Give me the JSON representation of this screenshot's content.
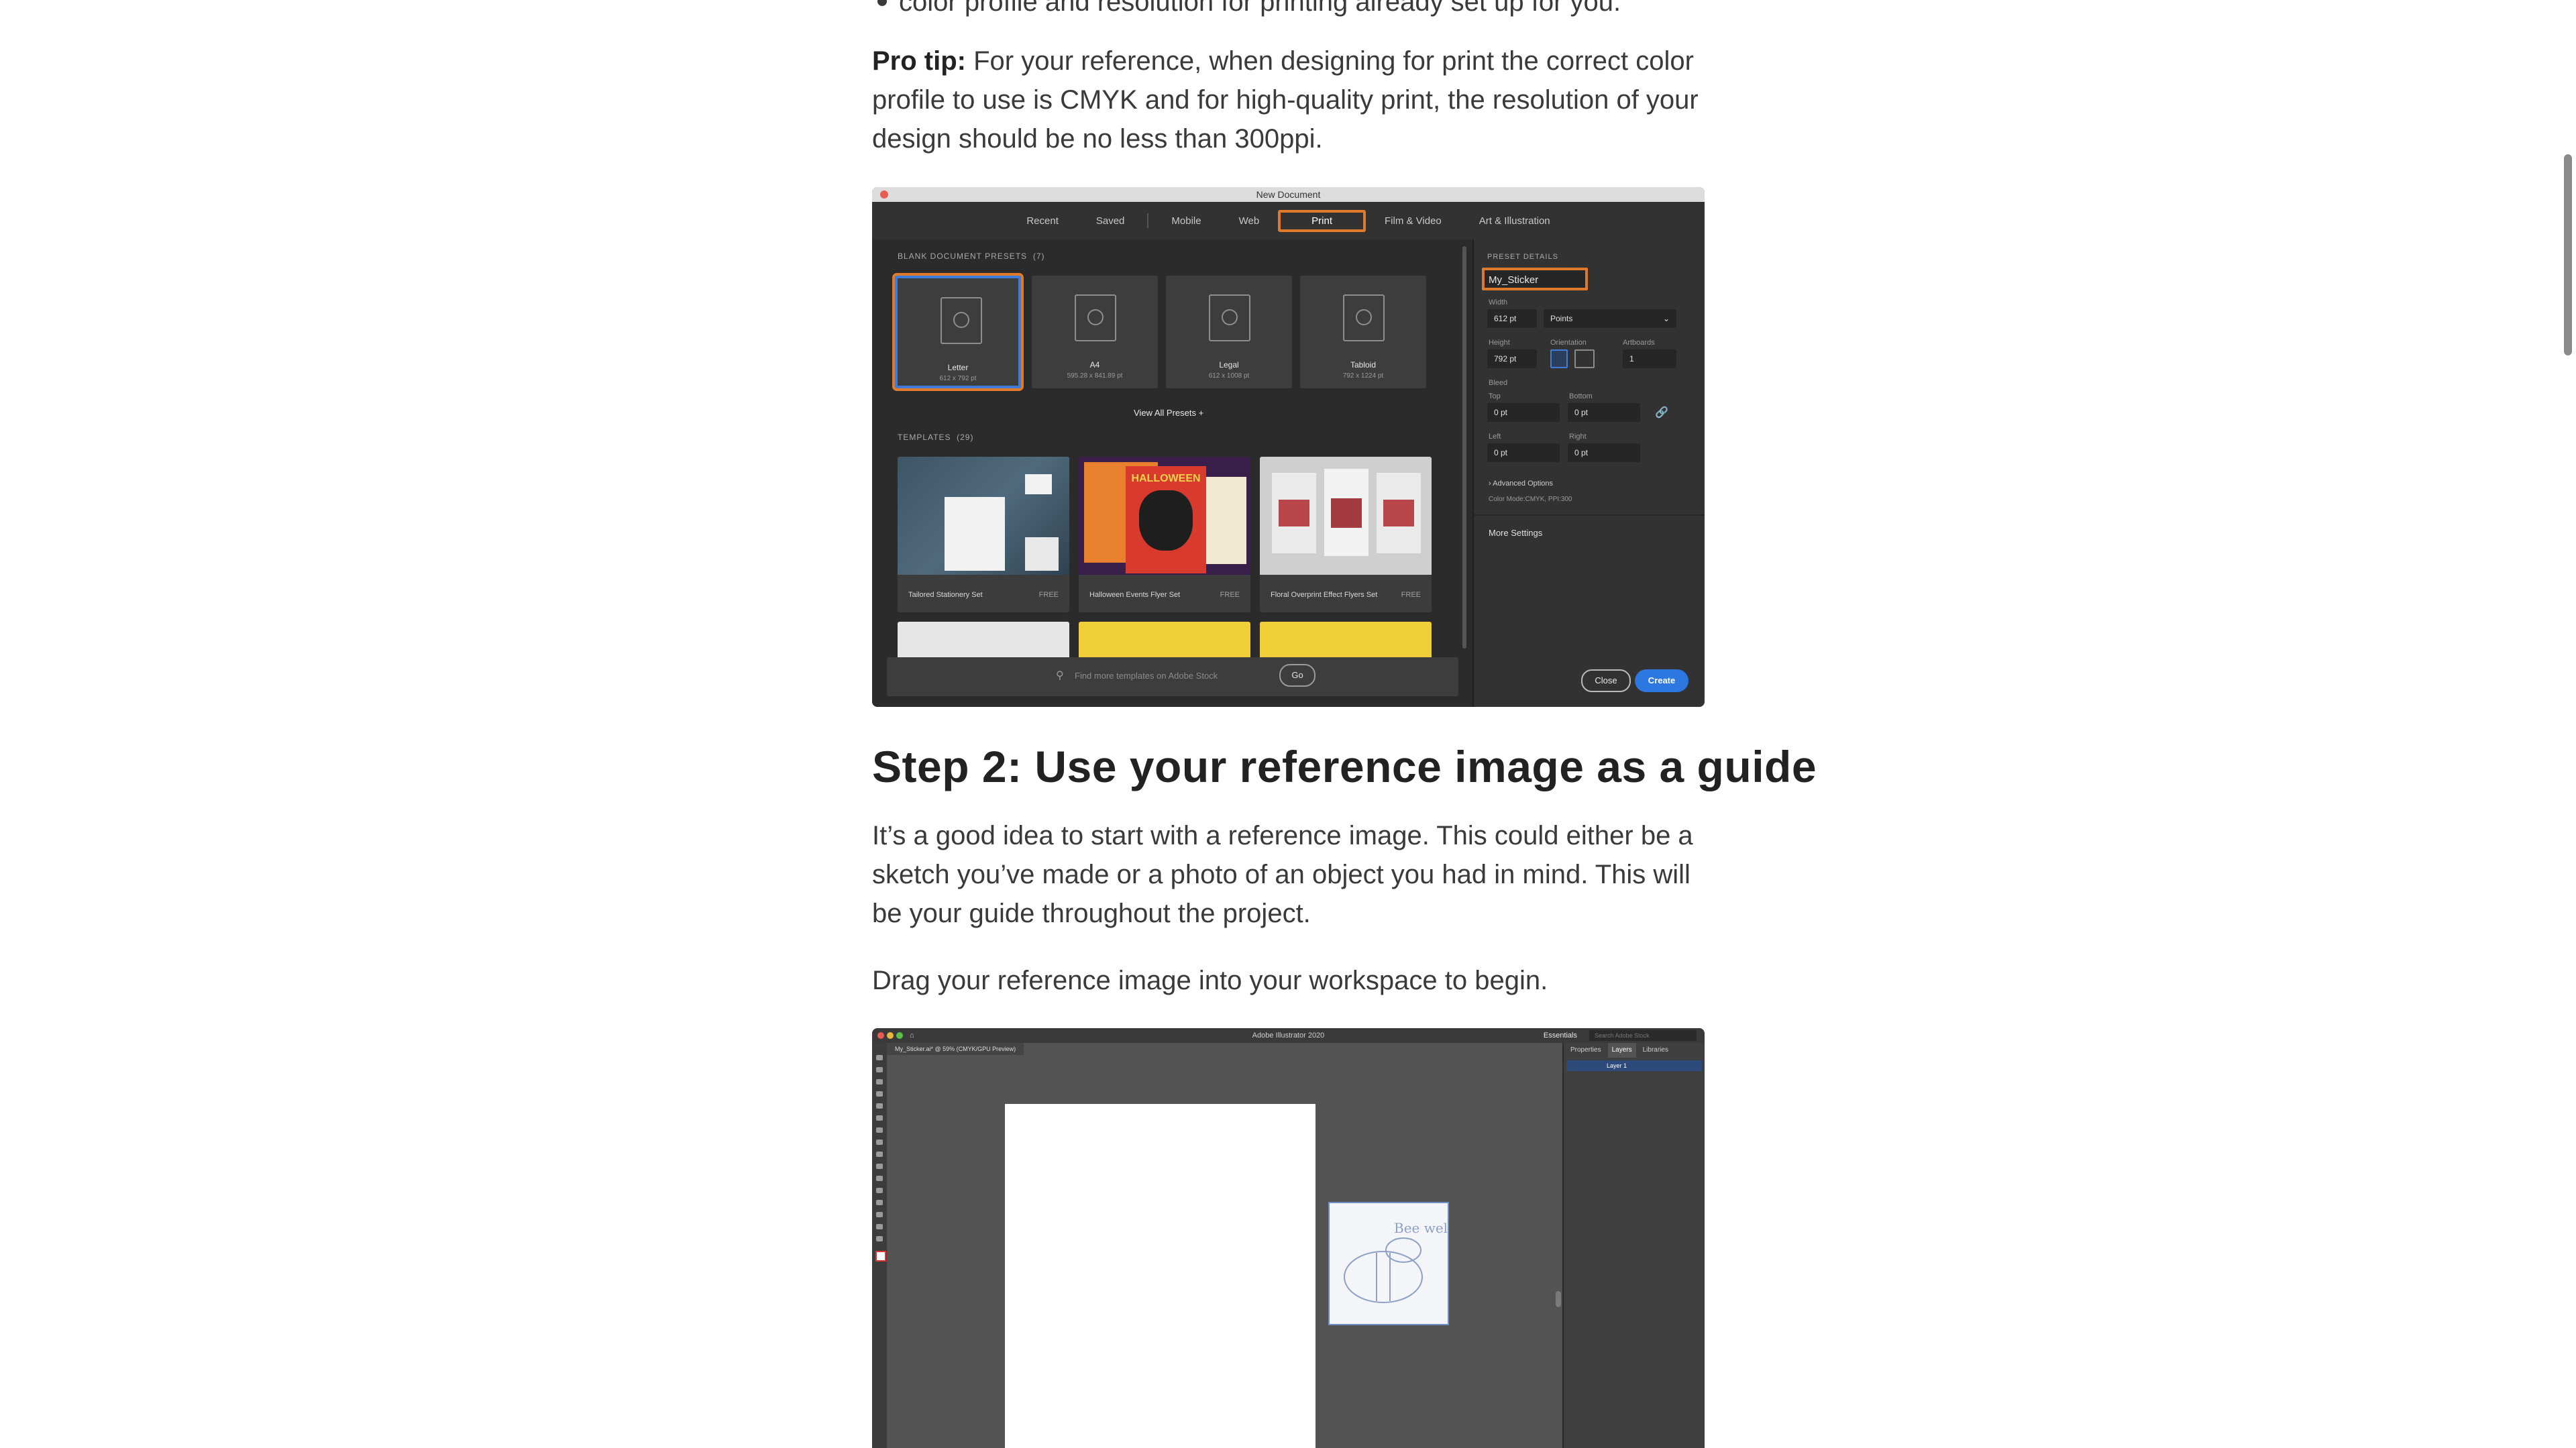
{
  "article": {
    "prev_line": "color profile and resolution for printing already set up for you.",
    "pro_tip_label": "Pro tip:",
    "pro_tip_text": " For your reference, when designing for print the correct color profile to use is CMYK and for high-quality print, the resolution of your design should be no less than 300ppi.",
    "step2_heading": "Step 2: Use your reference image as a guide",
    "step2_para": "It’s a good idea to start with a reference image. This could either be a sketch you’ve made or a photo of an object you had in mind. This will be your guide throughout the project.",
    "drag_para": "Drag your reference image into your workspace to begin."
  },
  "new_document": {
    "title": "New Document",
    "tabs": [
      "Recent",
      "Saved",
      "Mobile",
      "Web",
      "Print",
      "Film & Video",
      "Art & Illustration"
    ],
    "active_tab": "Print",
    "presets_header": "BLANK DOCUMENT PRESETS",
    "presets_count": "(7)",
    "presets": [
      {
        "name": "Letter",
        "dim": "612 x 792 pt"
      },
      {
        "name": "A4",
        "dim": "595.28 x 841.89 pt"
      },
      {
        "name": "Legal",
        "dim": "612 x 1008 pt"
      },
      {
        "name": "Tabloid",
        "dim": "792 x 1224 pt"
      }
    ],
    "view_all": "View All Presets  +",
    "templates_header": "TEMPLATES",
    "templates_count": "(29)",
    "templates": [
      {
        "name": "Tailored Stationery Set",
        "tag": "FREE"
      },
      {
        "name": "Halloween Events Flyer Set",
        "tag": "FREE"
      },
      {
        "name": "Floral Overprint Effect Flyers Set",
        "tag": "FREE"
      }
    ],
    "halloween_text": "HALLOWEEN",
    "search_placeholder": "Find more templates on Adobe Stock",
    "go_label": "Go",
    "details": {
      "header": "PRESET DETAILS",
      "name_value": "My_Sticker",
      "width_label": "Width",
      "width_value": "612 pt",
      "units_value": "Points",
      "height_label": "Height",
      "height_value": "792 pt",
      "orientation_label": "Orientation",
      "artboards_label": "Artboards",
      "artboards_value": "1",
      "bleed_label": "Bleed",
      "top_label": "Top",
      "top_value": "0 pt",
      "bottom_label": "Bottom",
      "bottom_value": "0 pt",
      "left_label": "Left",
      "left_value": "0 pt",
      "right_label": "Right",
      "right_value": "0 pt",
      "advanced": "› Advanced Options",
      "color_mode": "Color Mode:CMYK, PPI:300",
      "more_settings": "More Settings"
    },
    "close_label": "Close",
    "create_label": "Create"
  },
  "illustrator": {
    "app_title": "Adobe Illustrator 2020",
    "workspace": "Essentials",
    "search_placeholder": "Search Adobe Stock",
    "doc_tab": "My_Sticker.ai* @ 59% (CMYK/GPU Preview)",
    "panel_tabs": [
      "Properties",
      "Layers",
      "Libraries"
    ],
    "active_panel_tab": "Layers",
    "layer_name": "Layer 1",
    "sketch_text": "Bee well."
  },
  "colors": {
    "highlight": "#e07a2b",
    "selection": "#3f7bd9",
    "create_button": "#2d77e0"
  }
}
